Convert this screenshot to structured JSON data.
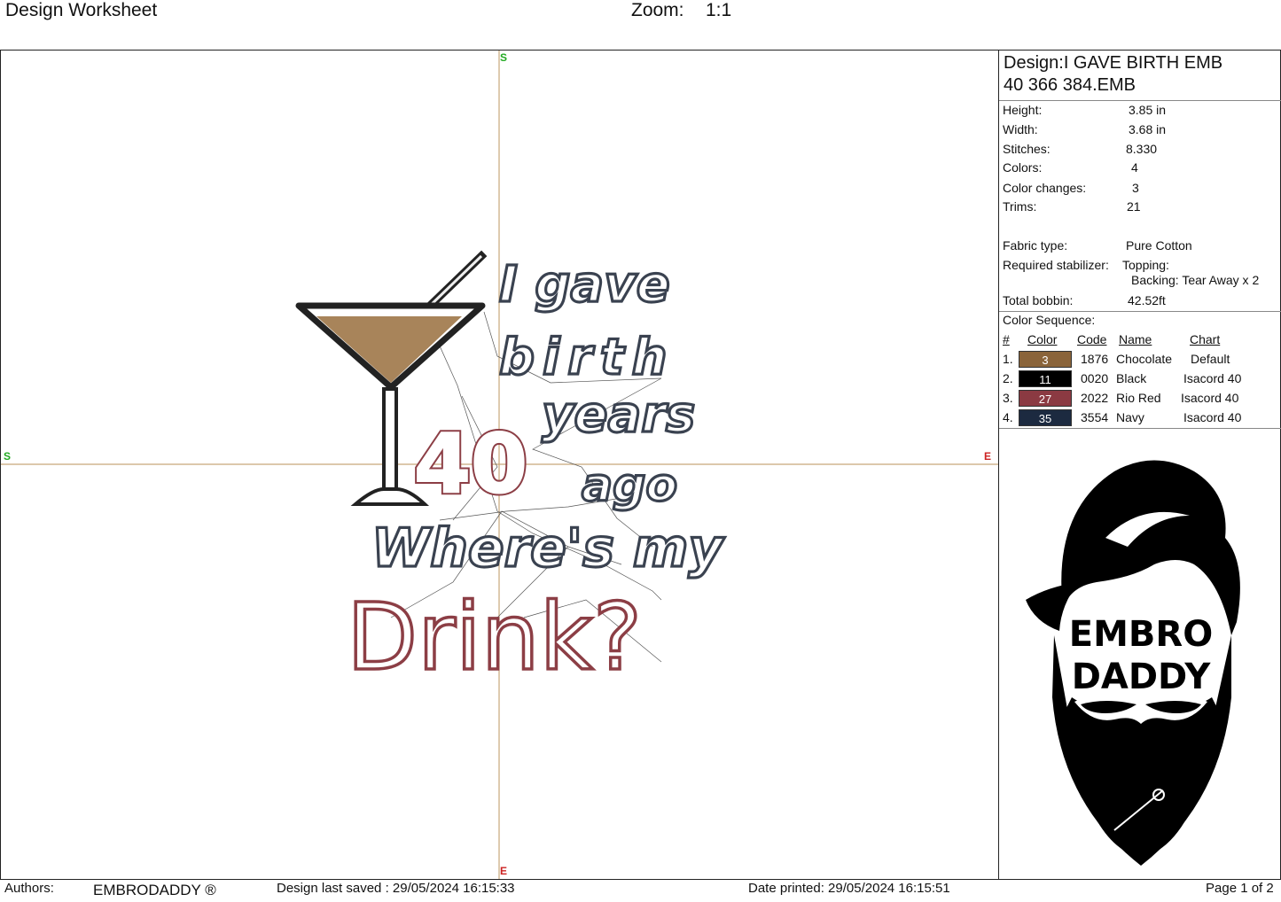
{
  "header": {
    "title": "Design Worksheet",
    "zoom_label": "Zoom:",
    "zoom_value": "1:1"
  },
  "canvas": {
    "axis_labels": {
      "top": "S",
      "bottom": "E",
      "left": "S",
      "right": "E"
    },
    "design_text": {
      "line1": "I gave",
      "line2": "birth",
      "number": "40",
      "line3": "years",
      "line4": "ago",
      "line5": "Where's my",
      "line6": "Drink?"
    },
    "colors": {
      "navy": "#3a4250",
      "red": "#8c3e45",
      "chocolate": "#a8845a",
      "black": "#222222",
      "crosshair": "#c8a87a"
    }
  },
  "panel": {
    "design_line1": "Design:I GAVE BIRTH EMB",
    "design_line2": "40 366 384.EMB",
    "info": [
      {
        "label": "Height:",
        "value": "3.85 in"
      },
      {
        "label": "Width:",
        "value": "3.68 in"
      },
      {
        "label": "Stitches:",
        "value": "8.330"
      },
      {
        "label": "Colors:",
        "value": "4"
      },
      {
        "label": "Color changes:",
        "value": "3"
      },
      {
        "label": "Trims:",
        "value": "21"
      }
    ],
    "fabric_label": "Fabric type:",
    "fabric_value": "Pure Cotton",
    "stabilizer_label": "Required stabilizer:",
    "topping": "Topping:",
    "backing": "Backing: Tear Away x 2",
    "bobbin_label": "Total bobbin:",
    "bobbin_value": "42.52ft",
    "sequence_title": "Color Sequence:",
    "sequence_headers": {
      "num": "#",
      "color": "Color",
      "code": "Code",
      "name": "Name",
      "chart": "Chart"
    },
    "sequence": [
      {
        "num": "1.",
        "color_num": "3",
        "hex": "#8a643a",
        "code": "1876",
        "name": "Chocolate",
        "chart": "Default"
      },
      {
        "num": "2.",
        "color_num": "11",
        "hex": "#000000",
        "code": "0020",
        "name": "Black",
        "chart": "Isacord 40"
      },
      {
        "num": "3.",
        "color_num": "27",
        "hex": "#8b3a42",
        "code": "2022",
        "name": "Rio Red",
        "chart": "Isacord 40"
      },
      {
        "num": "4.",
        "color_num": "35",
        "hex": "#1c2a40",
        "code": "3554",
        "name": "Navy",
        "chart": "Isacord 40"
      }
    ],
    "logo_line1": "EMBRO",
    "logo_line2": "DADDY"
  },
  "footer": {
    "authors_label": "Authors:",
    "authors_value": "EMBRODADDY ®",
    "saved": "Design last saved : 29/05/2024 16:15:33",
    "printed": "Date printed: 29/05/2024 16:15:51",
    "page": "Page 1 of 2"
  }
}
